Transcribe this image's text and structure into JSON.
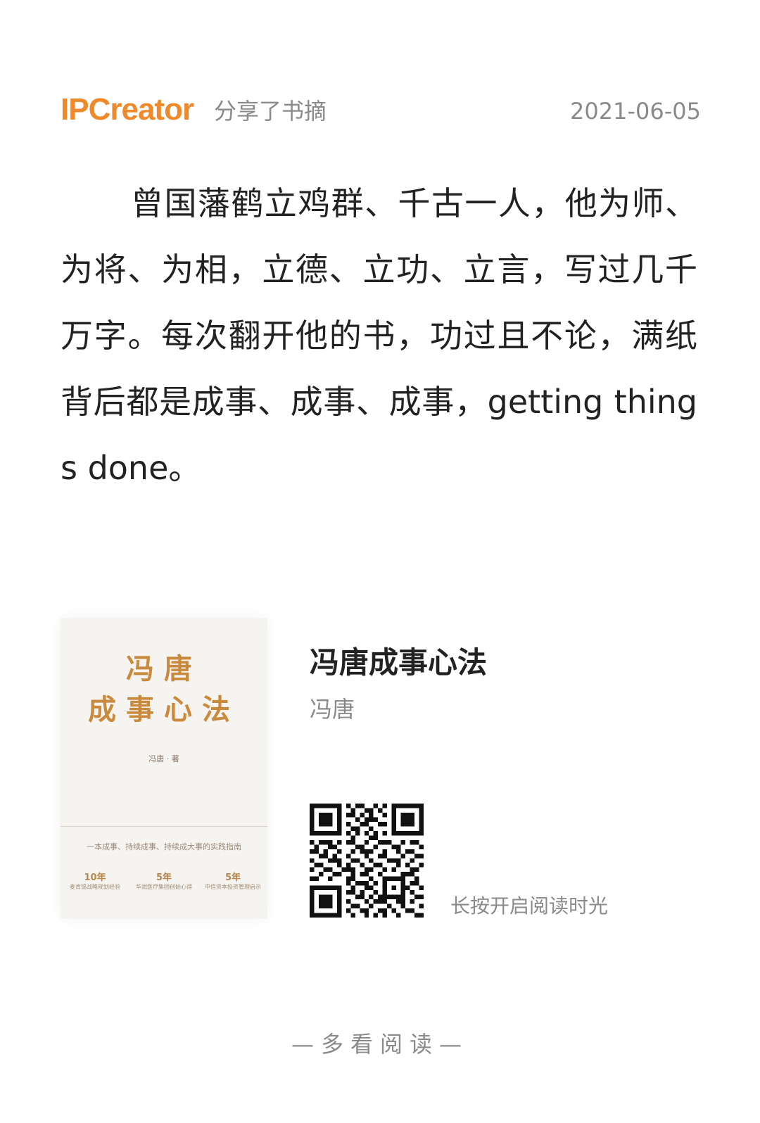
{
  "header": {
    "brand": "IPCreator",
    "action": "分享了书摘",
    "date": "2021-06-05"
  },
  "quote": {
    "text": "曾国藩鹤立鸡群、千古一人，他为师、为将、为相，立德、立功、立言，写过几千万字。每次翻开他的书，功过且不论，满纸背后都是成事、成事、成事，getting things done。"
  },
  "book": {
    "title": "冯唐成事心法",
    "author": "冯唐",
    "cover": {
      "title_line1": "冯唐",
      "title_line2": "成事心法",
      "author": "冯唐 · 著",
      "tagline": "一本成事、持续成事、持续成大事的实践指南",
      "stats": [
        {
          "num": "10年",
          "label": "麦肯锡战略规划经验"
        },
        {
          "num": "5年",
          "label": "华润医疗集团创始心得"
        },
        {
          "num": "5年",
          "label": "中信资本投资管理启示"
        }
      ]
    },
    "qr_caption": "长按开启阅读时光"
  },
  "footer": {
    "label": "—多看阅读—"
  },
  "colors": {
    "brand": "#ee8a2c",
    "muted": "#8a8a8a",
    "text": "#222222",
    "cover_gold": "#c98a3e"
  }
}
